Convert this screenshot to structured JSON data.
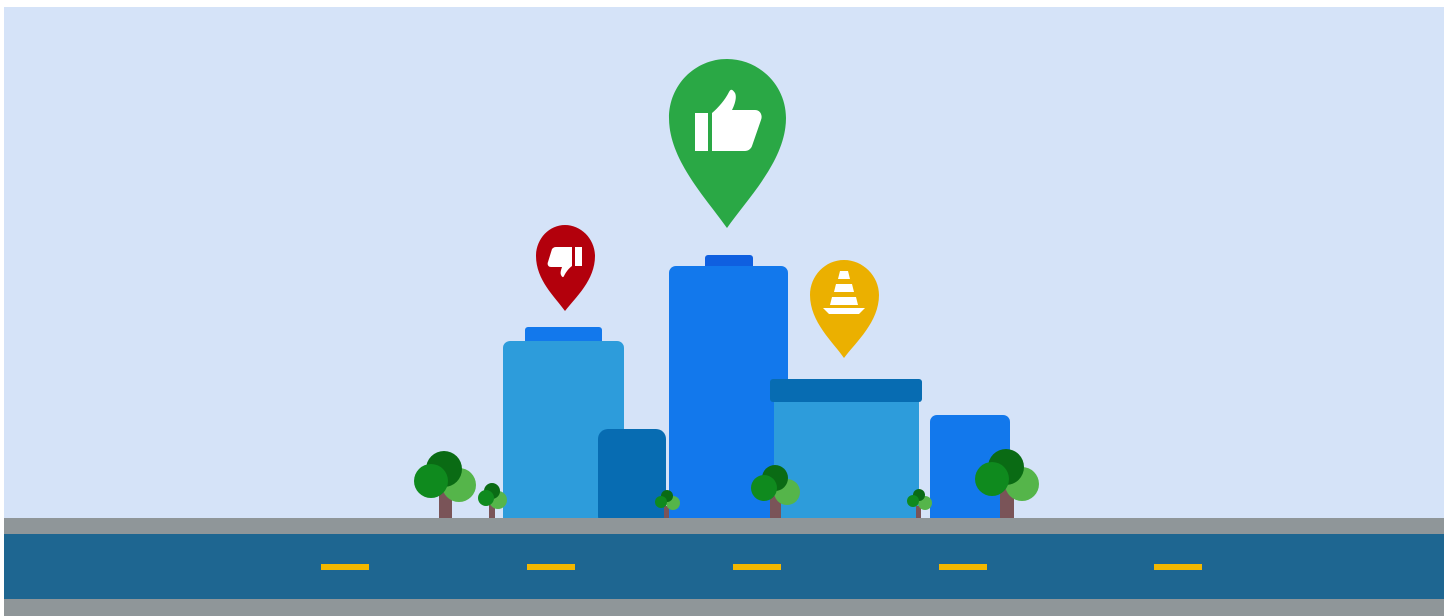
{
  "scene": {
    "sky_color": "#d5e3f8",
    "sidewalk_color": "#8f9699",
    "road_color": "#1e6691",
    "lane_marking_color": "#f3b700",
    "building_colors": {
      "light_blue": "#2d9cdb",
      "bright_blue": "#1278ec",
      "dark_blue": "#076cb2",
      "cap_blue": "#0f5fe0"
    },
    "tree_colors": {
      "trunk": "#7a5458",
      "dark_green": "#0a6b14",
      "mid_green": "#0f8a1e",
      "light_green": "#55b54a"
    },
    "markers": [
      {
        "name": "thumbs-up-marker",
        "icon": "thumbs-up-icon",
        "color": "#2aa845"
      },
      {
        "name": "thumbs-down-marker",
        "icon": "thumbs-down-icon",
        "color": "#b3000c"
      },
      {
        "name": "traffic-cone-marker",
        "icon": "traffic-cone-icon",
        "color": "#ebb000"
      }
    ]
  }
}
